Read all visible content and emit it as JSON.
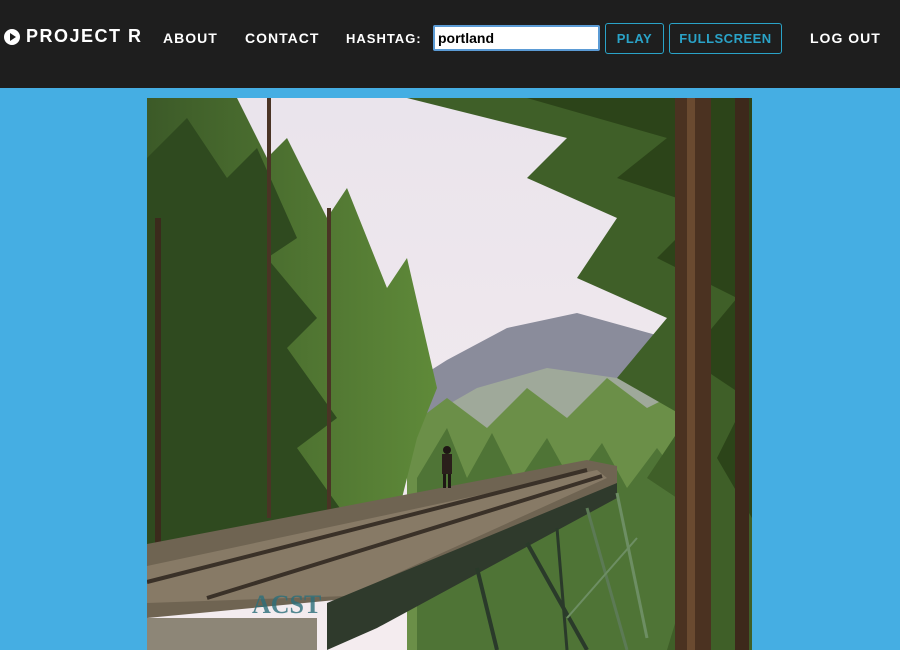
{
  "header": {
    "brand": "PROJECT R",
    "brand_icon": "play-circle-icon",
    "nav": {
      "about": "ABOUT",
      "contact": "CONTACT"
    },
    "hashtag_label": "HASHTAG:",
    "hashtag_value": "portland",
    "play_label": "PLAY",
    "fullscreen_label": "FULLSCREEN",
    "logout_label": "LOG OUT"
  },
  "colors": {
    "background": "#45aee3",
    "navbar": "#1e1e1e",
    "button_accent": "#2aa3c8",
    "input_border": "#5b9bd5"
  },
  "content": {
    "photo_text": "ACST"
  }
}
